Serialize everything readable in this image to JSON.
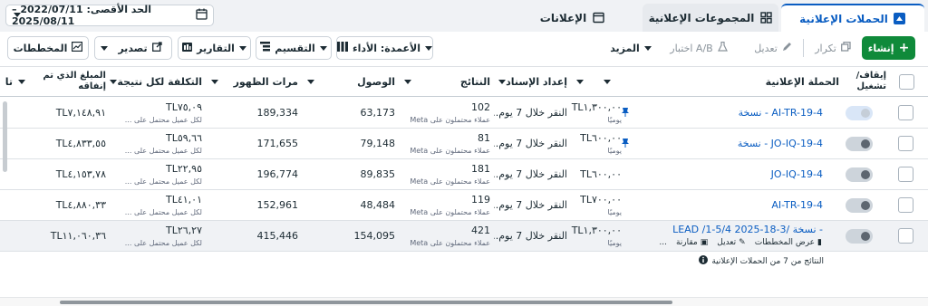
{
  "tabs": {
    "campaigns": "الحملات الإعلانية",
    "adsets": "المجموعات الإعلانية",
    "ads": "الإعلانات"
  },
  "date_range": "الحد الأقصى: 2022/07/11 – 2025/08/11",
  "toolbar": {
    "create": "إنشاء",
    "duplicate": "تكرار",
    "edit": "تعديل",
    "ab_test": "اختبار A/B",
    "more": "المزيد",
    "columns": "الأعمدة: الأداء",
    "breakdown": "التقسيم",
    "reports": "التقارير",
    "export": "تصدير",
    "charts": "المخططات"
  },
  "columns": {
    "toggle": "إيقاف/ تشغيل",
    "campaign": "الحملة الإعلانية",
    "budget": "",
    "attribution": "إعداد الإسناد",
    "results": "النتائج",
    "reach": "الوصول",
    "impressions": "مرات الظهور",
    "cost_per_result": "التكلفة لكل نتيجة",
    "amount_spent": "المبلغ الذي تم إنفاقه",
    "ends": "تا"
  },
  "rows": [
    {
      "name": "AI-TR-19-4 - نسخة",
      "budget": "TL١,٣٠٠,٠٠",
      "budget_sub": "يوميًا",
      "attribution": "النقر خلال 7 يوم...",
      "results": "102",
      "results_sub": "عملاء محتملون على Meta",
      "reach": "63,173",
      "impressions": "189,334",
      "cost": "TL٧٥,٠٩",
      "cost_sub": "لكل عميل محتمل على ...",
      "spent": "TL٧,١٤٨,٩١",
      "pinned": true,
      "toggle_state": "light"
    },
    {
      "name": "JO-IQ-19-4 - نسخة",
      "budget": "TL٦٠٠,٠٠",
      "budget_sub": "يوميًا",
      "attribution": "النقر خلال 7 يوم...",
      "results": "81",
      "results_sub": "عملاء محتملون على Meta",
      "reach": "79,148",
      "impressions": "171,655",
      "cost": "TL٥٩,٦٦",
      "cost_sub": "لكل عميل محتمل على ...",
      "spent": "TL٤,٨٣٣,٥٥",
      "pinned": true,
      "toggle_state": "dark"
    },
    {
      "name": "JO-IQ-19-4",
      "budget": "TL٦٠٠,٠٠",
      "budget_sub": "",
      "attribution": "النقر خلال 7 يوم...",
      "results": "181",
      "results_sub": "عملاء محتملون على Meta",
      "reach": "89,835",
      "impressions": "196,774",
      "cost": "TL٢٢,٩٥",
      "cost_sub": "لكل عميل محتمل على ...",
      "spent": "TL٤,١٥٣,٧٨",
      "pinned": false,
      "toggle_state": "dark"
    },
    {
      "name": "AI-TR-19-4",
      "budget": "TL٧٠٠,٠٠",
      "budget_sub": "يوميًا",
      "attribution": "النقر خلال 7 يوم...",
      "results": "119",
      "results_sub": "عملاء محتملون على Meta",
      "reach": "48,484",
      "impressions": "152,961",
      "cost": "TL٤١,٠١",
      "cost_sub": "لكل عميل محتمل على ...",
      "spent": "TL٤,٨٨٠,٣٣",
      "pinned": false,
      "toggle_state": "dark"
    },
    {
      "name": "- نسخة /LEAD /1-5/4 2025-18-3",
      "budget": "TL١,٣٠٠,٠٠",
      "budget_sub": "يوميًا",
      "attribution": "النقر خلال 7 يوم...",
      "results": "421",
      "results_sub": "عملاء محتملون على Meta",
      "reach": "154,095",
      "impressions": "415,446",
      "cost": "TL٢٦,٢٧",
      "cost_sub": "لكل عميل محتمل على ...",
      "spent": "TL١١,٠٦٠,٣٦",
      "pinned": false,
      "toggle_state": "dark",
      "actions": {
        "charts": "عرض المخططات",
        "edit": "تعديل",
        "compare": "مقارنة",
        "more": "..."
      }
    }
  ],
  "summary": "النتائج من 7 من الحملات الإعلانية",
  "colors": {
    "accent": "#0a5dc2",
    "create": "#0f8a3a"
  }
}
